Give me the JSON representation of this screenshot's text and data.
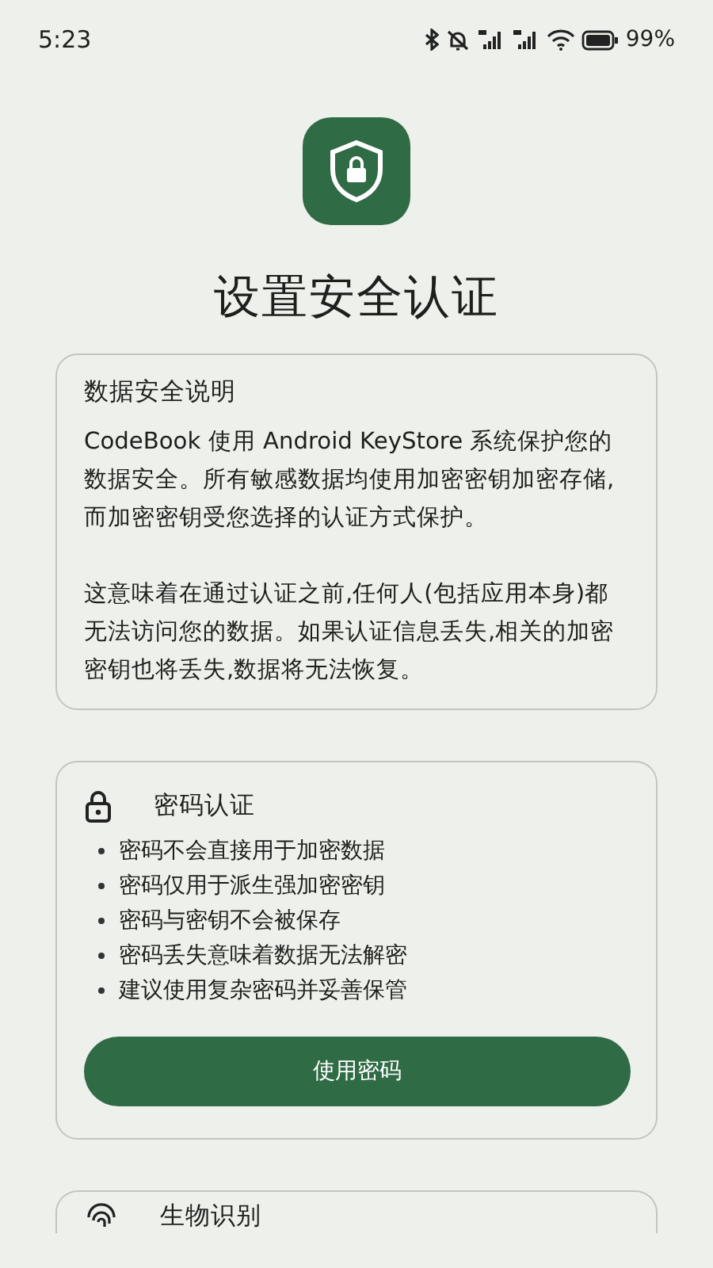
{
  "status_bar": {
    "time": "5:23",
    "battery": "99%"
  },
  "title": "设置安全认证",
  "info_card": {
    "title": "数据安全说明",
    "paragraphs": [
      "CodeBook 使用 Android KeyStore 系统保护您的数据安全。所有敏感数据均使用加密密钥加密存储,而加密密钥受您选择的认证方式保护。",
      "这意味着在通过认证之前,任何人(包括应用本身)都无法访问您的数据。如果认证信息丢失,相关的加密密钥也将丢失,数据将无法恢复。"
    ]
  },
  "methods": [
    {
      "kind": "password",
      "title": "密码认证",
      "points": [
        "密码不会直接用于加密数据",
        "密码仅用于派生强加密密钥",
        "密码与密钥不会被保存",
        "密码丢失意味着数据无法解密",
        "建议使用复杂密码并妥善保管"
      ],
      "button": "使用密码"
    },
    {
      "kind": "biometric",
      "title": "生物识别"
    }
  ]
}
